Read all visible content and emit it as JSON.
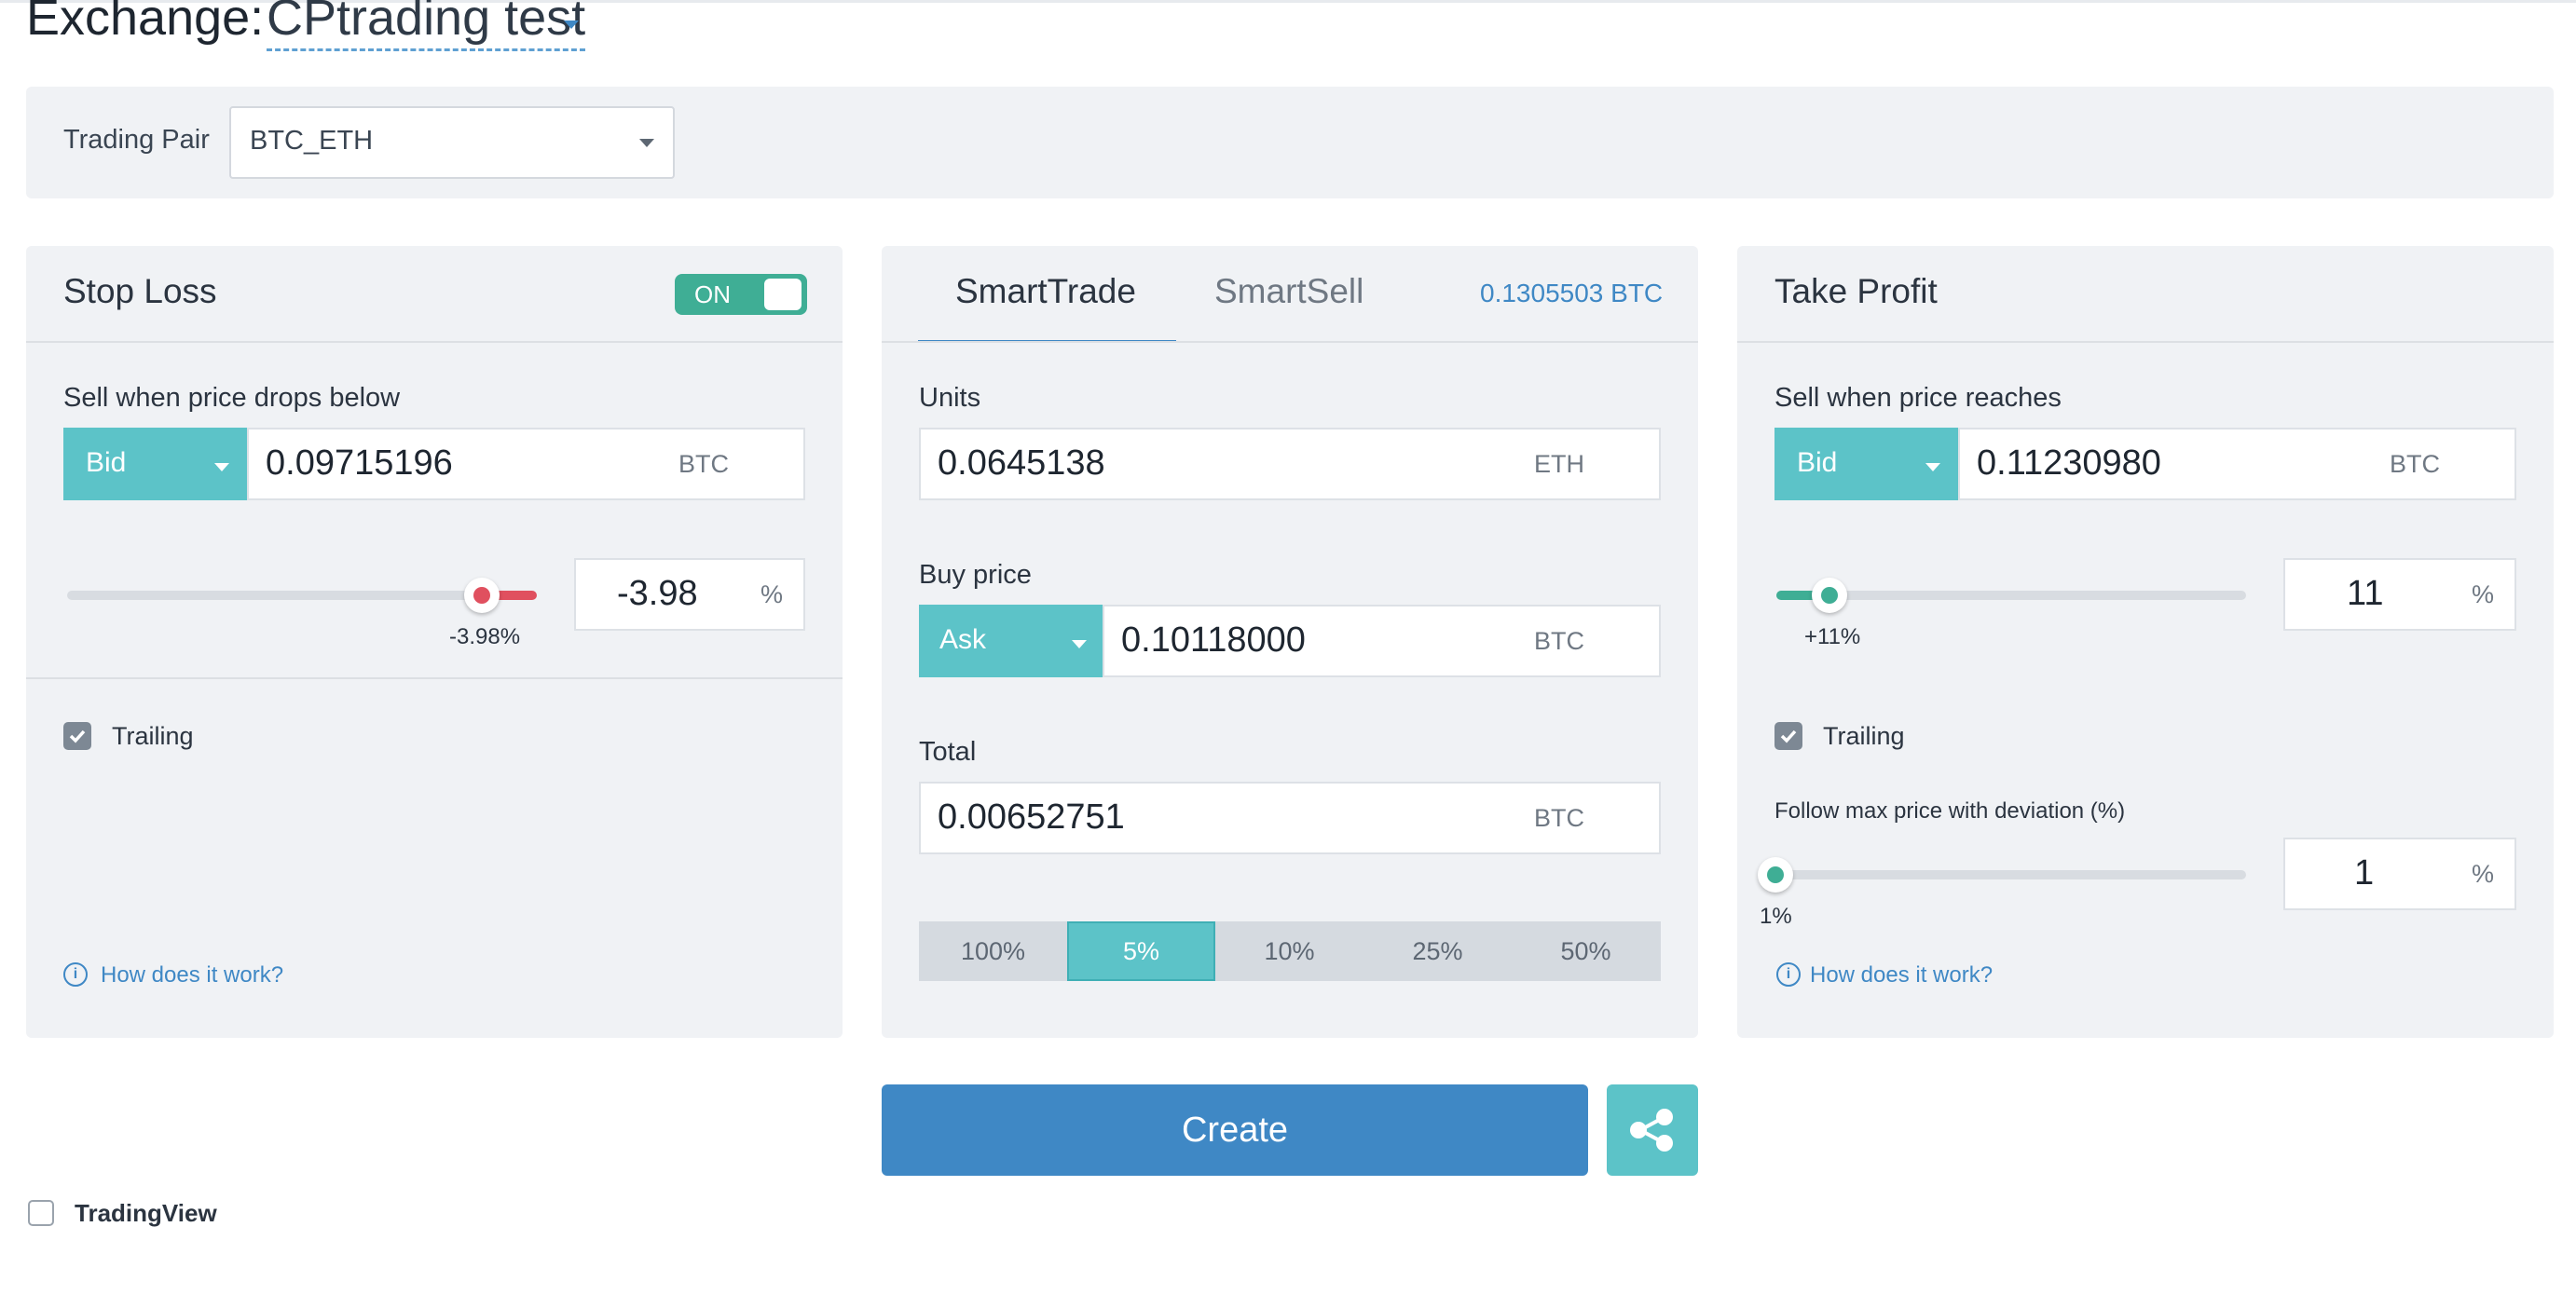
{
  "header": {
    "label": "Exchange:",
    "exchange_name": "CPtrading test"
  },
  "pair": {
    "label": "Trading Pair",
    "value": "BTC_ETH"
  },
  "stop_loss": {
    "title": "Stop Loss",
    "toggle": "ON",
    "sell_label": "Sell when price drops below",
    "price_type": "Bid",
    "price": "0.09715196",
    "unit": "BTC",
    "percent_value": "-3.98",
    "percent_unit": "%",
    "slider_label": "-3.98%",
    "trailing_label": "Trailing",
    "trailing_checked": true,
    "help_link": "How does it work?"
  },
  "smart": {
    "tabs": [
      "SmartTrade",
      "SmartSell"
    ],
    "active_tab": "SmartTrade",
    "balance": "0.1305503 BTC",
    "units_label": "Units",
    "units_value": "0.0645138",
    "units_unit": "ETH",
    "buy_label": "Buy price",
    "buy_type": "Ask",
    "buy_price": "0.10118000",
    "buy_unit": "BTC",
    "total_label": "Total",
    "total_value": "0.00652751",
    "total_unit": "BTC",
    "percent_buttons": [
      "100%",
      "5%",
      "10%",
      "25%",
      "50%"
    ],
    "active_percent": "5%"
  },
  "take_profit": {
    "title": "Take Profit",
    "sell_label": "Sell when price reaches",
    "price_type": "Bid",
    "price": "0.11230980",
    "unit": "BTC",
    "percent_value": "11",
    "percent_unit": "%",
    "slider_label": "+11%",
    "trailing_label": "Trailing",
    "trailing_checked": true,
    "deviation_label": "Follow max price with deviation (%)",
    "deviation_value": "1",
    "deviation_unit": "%",
    "deviation_slider_label": "1%",
    "help_link": "How does it work?"
  },
  "actions": {
    "create": "Create"
  },
  "tradingview": {
    "label": "TradingView",
    "checked": false
  },
  "colors": {
    "teal": "#5cc3c8",
    "blue": "#3f88c5",
    "green": "#3fae95",
    "red": "#e0505f"
  }
}
